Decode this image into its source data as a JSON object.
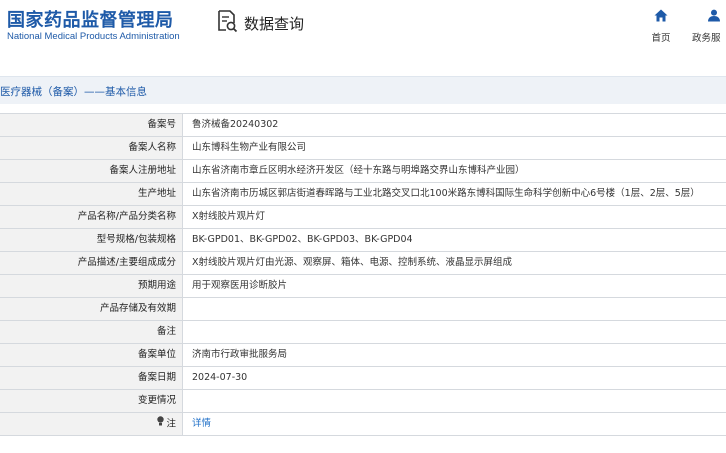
{
  "header": {
    "logo_cn": "国家药品监督管理局",
    "logo_en": "National Medical Products Administration",
    "app_title": "数据查询",
    "nav": [
      {
        "label": "首页",
        "icon": "home-icon"
      },
      {
        "label": "政务服",
        "icon": "user-icon"
      }
    ]
  },
  "breadcrumb": "医疗器械（备案）——基本信息",
  "record": [
    {
      "label": "备案号",
      "value": "鲁济械备20240302"
    },
    {
      "label": "备案人名称",
      "value": "山东博科生物产业有限公司"
    },
    {
      "label": "备案人注册地址",
      "value": "山东省济南市章丘区明水经济开发区（经十东路与明埠路交界山东博科产业园）"
    },
    {
      "label": "生产地址",
      "value": "山东省济南市历城区郭店街道春晖路与工业北路交叉口北100米路东博科国际生命科学创新中心6号楼（1层、2层、5层）"
    },
    {
      "label": "产品名称/产品分类名称",
      "value": "X射线胶片观片灯"
    },
    {
      "label": "型号规格/包装规格",
      "value": "BK-GPD01、BK-GPD02、BK-GPD03、BK-GPD04"
    },
    {
      "label": "产品描述/主要组成成分",
      "value": "X射线胶片观片灯由光源、观察屏、箱体、电源、控制系统、液晶显示屏组成"
    },
    {
      "label": "预期用途",
      "value": "用于观察医用诊断胶片"
    },
    {
      "label": "产品存储及有效期",
      "value": ""
    },
    {
      "label": "备注",
      "value": ""
    },
    {
      "label": "备案单位",
      "value": "济南市行政审批服务局"
    },
    {
      "label": "备案日期",
      "value": "2024-07-30"
    },
    {
      "label": "变更情况",
      "value": ""
    },
    {
      "label": "注",
      "value": "详情"
    }
  ],
  "colors": {
    "brand": "#1e5aa8",
    "link": "#1e6fc8",
    "label_bg": "#f2f2f2",
    "bar_bg": "#eef2f7"
  }
}
